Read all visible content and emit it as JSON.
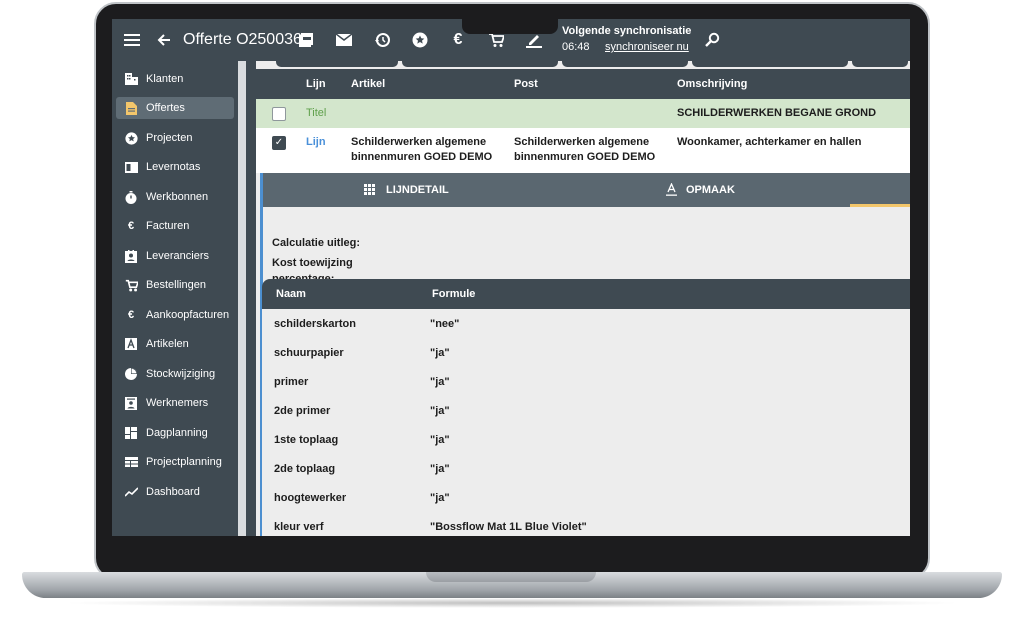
{
  "header": {
    "title": "Offerte O250036",
    "sync_title": "Volgende synchronisatie",
    "sync_time": "06:48",
    "sync_link": "synchroniseer nu"
  },
  "sidebar": {
    "items": [
      {
        "label": "Klanten",
        "icon": "building-icon"
      },
      {
        "label": "Offertes",
        "icon": "document-icon",
        "active": true
      },
      {
        "label": "Projecten",
        "icon": "star-circle-icon"
      },
      {
        "label": "Levernotas",
        "icon": "card-icon"
      },
      {
        "label": "Werkbonnen",
        "icon": "stopwatch-icon"
      },
      {
        "label": "Facturen",
        "icon": "euro-icon"
      },
      {
        "label": "Leveranciers",
        "icon": "contact-icon"
      },
      {
        "label": "Bestellingen",
        "icon": "cart-icon"
      },
      {
        "label": "Aankoopfacturen",
        "icon": "euro-icon"
      },
      {
        "label": "Artikelen",
        "icon": "letter-a-icon"
      },
      {
        "label": "Stockwijziging",
        "icon": "pie-icon"
      },
      {
        "label": "Werknemers",
        "icon": "badge-icon"
      },
      {
        "label": "Dagplanning",
        "icon": "dashboard-icon"
      },
      {
        "label": "Projectplanning",
        "icon": "table-icon"
      },
      {
        "label": "Dashboard",
        "icon": "trend-icon"
      }
    ]
  },
  "table": {
    "columns": {
      "lijn": "Lijn",
      "artikel": "Artikel",
      "post": "Post",
      "omschrijving": "Omschrijving"
    },
    "titel_row": {
      "type": "Titel",
      "omschrijving": "SCHILDERWERKEN BEGANE GROND"
    },
    "lijn_row": {
      "type": "Lijn",
      "artikel_1": "Schilderwerken algemene",
      "artikel_2": "binnenmuren GOED DEMO",
      "post_1": "Schilderwerken algemene",
      "post_2": "binnenmuren GOED DEMO",
      "omschrijving": "Woonkamer, achterkamer en hallen"
    }
  },
  "detail": {
    "tab_lijndetail": "LIJNDETAIL",
    "tab_opmaak": "OPMAAK",
    "calc_label": "Calculatie uitleg:",
    "kost_label_1": "Kost toewijzing",
    "kost_label_2": "percentage:"
  },
  "formulas": {
    "col_naam": "Naam",
    "col_formule": "Formule",
    "rows": [
      {
        "naam": "schilderskarton",
        "formule": "\"nee\""
      },
      {
        "naam": "schuurpapier",
        "formule": "\"ja\""
      },
      {
        "naam": "primer",
        "formule": "\"ja\""
      },
      {
        "naam": "2de primer",
        "formule": "\"ja\""
      },
      {
        "naam": "1ste toplaag",
        "formule": "\"ja\""
      },
      {
        "naam": "2de toplaag",
        "formule": "\"ja\""
      },
      {
        "naam": "hoogtewerker",
        "formule": "\"ja\""
      },
      {
        "naam": "kleur verf",
        "formule": "\"Bossflow Mat 1L Blue Violet\""
      }
    ]
  },
  "colors": {
    "bar": "#3f4a52",
    "active_item": "#5f6c75",
    "titel_row": "#d3e6cc",
    "titel_text": "#5fa04b",
    "lijn_text": "#4a90d9",
    "accent": "#f3c66b"
  }
}
